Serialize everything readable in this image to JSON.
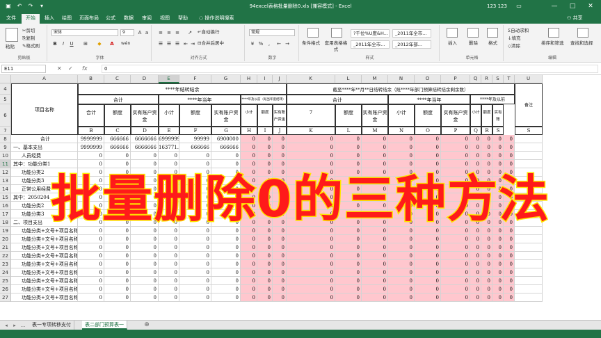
{
  "app": {
    "doc_title": "94excel表格批量删除0.xls [兼容模式] - Excel",
    "user": "123 123",
    "window_buttons": [
      "—",
      "□",
      "✕"
    ],
    "quick_access": [
      "save-icon",
      "undo-icon",
      "redo-icon",
      "customize-icon"
    ]
  },
  "tabs": [
    "文件",
    "开始",
    "插入",
    "绘图",
    "页面布局",
    "公式",
    "数据",
    "审阅",
    "视图",
    "帮助"
  ],
  "tell_me": "操作说明搜索",
  "share": "共享",
  "ribbon": {
    "clipboard": {
      "paste": "粘贴",
      "cut": "剪切",
      "copy": "复制",
      "painter": "格式刷",
      "label": "剪贴板"
    },
    "font": {
      "name": "宋体",
      "size": "9",
      "bold": "B",
      "italic": "I",
      "underline": "U",
      "wen": "wén",
      "label": "字体"
    },
    "align": {
      "wrap": "自动换行",
      "merge": "合并后居中",
      "label": "对齐方式"
    },
    "number": {
      "format": "常规",
      "percent": "%",
      "comma": ",",
      "label": "数字"
    },
    "styles": {
      "cond": "条件格式",
      "table": "套用表格格式",
      "cell": "单元格样式",
      "boxes": [
        "?千位%U度&H...",
        "_2011年全市...",
        "_2011年全市...",
        "_2012年部..."
      ],
      "label": "样式"
    },
    "cells": {
      "insert": "插入",
      "delete": "删除",
      "format": "格式",
      "label": "单元格"
    },
    "edit": {
      "autosum": "自动求和",
      "fill": "填充",
      "clear": "清除",
      "sort": "排序和筛选",
      "find": "查找和选择",
      "label": "编辑"
    }
  },
  "formula": {
    "cell": "E11",
    "fx": "fx",
    "value": "0"
  },
  "grid": {
    "cols": [
      "A",
      "B",
      "C",
      "D",
      "E",
      "F",
      "G",
      "H",
      "I",
      "J",
      "K",
      "L",
      "M",
      "N",
      "O",
      "P",
      "Q",
      "R",
      "S",
      "T",
      "U"
    ],
    "rows": [
      "4",
      "5",
      "6",
      "7",
      "8",
      "9",
      "10",
      "11",
      "12",
      "13",
      "14",
      "15",
      "16",
      "17",
      "18",
      "19",
      "20",
      "21",
      "22",
      "23",
      "24",
      "25",
      "26",
      "27"
    ],
    "hdr": {
      "project": "项目名称",
      "carry_over": "****年结转结余",
      "subtotal_total": "合计",
      "current_year": "****年当年",
      "prior_year": "****年及以前（既当年度结转）",
      "as_of": "截至****年**月**日结转结余（既****年部门预算结转结余剩余数）",
      "total2": "合计",
      "current2": "****年当年",
      "prior2": "****年及以前",
      "note": "备注",
      "sub": [
        "合计",
        "额度",
        "实有账户资金",
        "小计",
        "额度",
        "实有账户资金",
        "小计",
        "额度",
        "实有账户资金",
        "7",
        "额度",
        "实有账户资金",
        "小计",
        "额度",
        "实有账户资金",
        "小计",
        "额度",
        "实有账"
      ],
      "letters": [
        "A",
        "B",
        "C",
        "D",
        "E",
        "F",
        "G",
        "H",
        "I",
        "J",
        "K",
        "L",
        "M",
        "N",
        "O",
        "P",
        "Q",
        "R",
        "S"
      ]
    },
    "data_rows": [
      {
        "name": "合计",
        "vals": [
          "9999999",
          "666666",
          "6666666",
          "6999999",
          "99999",
          "6900000"
        ]
      },
      {
        "name": "一、基本支出",
        "vals": [
          "9999999",
          "666666",
          "6666666",
          "163771.8",
          "666666",
          "666666"
        ]
      },
      {
        "name": "人员经费",
        "vals": [
          "0",
          "0",
          "0",
          "0",
          "0",
          "0"
        ]
      },
      {
        "name": "其中：功能分类1",
        "vals": [
          "0",
          "0",
          "0",
          "0",
          "0",
          "0"
        ]
      },
      {
        "name": "功能分类2",
        "vals": [
          "0",
          "0",
          "0",
          "0",
          "0",
          "0"
        ]
      },
      {
        "name": "功能分类3",
        "vals": [
          "0",
          "0",
          "0",
          "0",
          "0",
          "0"
        ]
      },
      {
        "name": "正常公用经费",
        "vals": [
          "0",
          "0",
          "0",
          "0",
          "0",
          "0"
        ]
      },
      {
        "name": "其中：2050204",
        "vals": [
          "0",
          "0",
          "0",
          "0",
          "0",
          "0"
        ]
      },
      {
        "name": "功能分类2",
        "vals": [
          "0",
          "0",
          "0",
          "0",
          "0",
          "0"
        ]
      },
      {
        "name": "功能分类3",
        "vals": [
          "0",
          "0",
          "0",
          "0",
          "0",
          "0"
        ]
      },
      {
        "name": "二、项目支出",
        "vals": [
          "0",
          "0",
          "0",
          "0",
          "0",
          "0"
        ]
      },
      {
        "name": "功能分类+文号+项目名称",
        "vals": [
          "0",
          "0",
          "0",
          "0",
          "0",
          "0"
        ]
      },
      {
        "name": "功能分类+文号+项目名称",
        "vals": [
          "0",
          "0",
          "0",
          "0",
          "0",
          "0"
        ]
      },
      {
        "name": "功能分类+文号+项目名称",
        "vals": [
          "0",
          "0",
          "0",
          "0",
          "0",
          "0"
        ]
      },
      {
        "name": "功能分类+文号+项目名称",
        "vals": [
          "0",
          "0",
          "0",
          "0",
          "0",
          "0"
        ]
      },
      {
        "name": "功能分类+文号+项目名称",
        "vals": [
          "0",
          "0",
          "0",
          "0",
          "0",
          "0"
        ]
      },
      {
        "name": "功能分类+文号+项目名称",
        "vals": [
          "0",
          "0",
          "0",
          "0",
          "0",
          "0"
        ]
      },
      {
        "name": "功能分类+文号+项目名称",
        "vals": [
          "0",
          "0",
          "0",
          "0",
          "0",
          "0"
        ]
      },
      {
        "name": "功能分类+文号+项目名称",
        "vals": [
          "0",
          "0",
          "0",
          "0",
          "0",
          "0"
        ]
      },
      {
        "name": "功能分类+文号+项目名称",
        "vals": [
          "0",
          "0",
          "0",
          "0",
          "0",
          "0"
        ]
      }
    ],
    "zero": "0"
  },
  "overlay_text": "批量删除0的三种方法",
  "sheets": [
    "表一专项转移支付",
    "表二部门预算表一"
  ],
  "sheet_add": "⊕"
}
